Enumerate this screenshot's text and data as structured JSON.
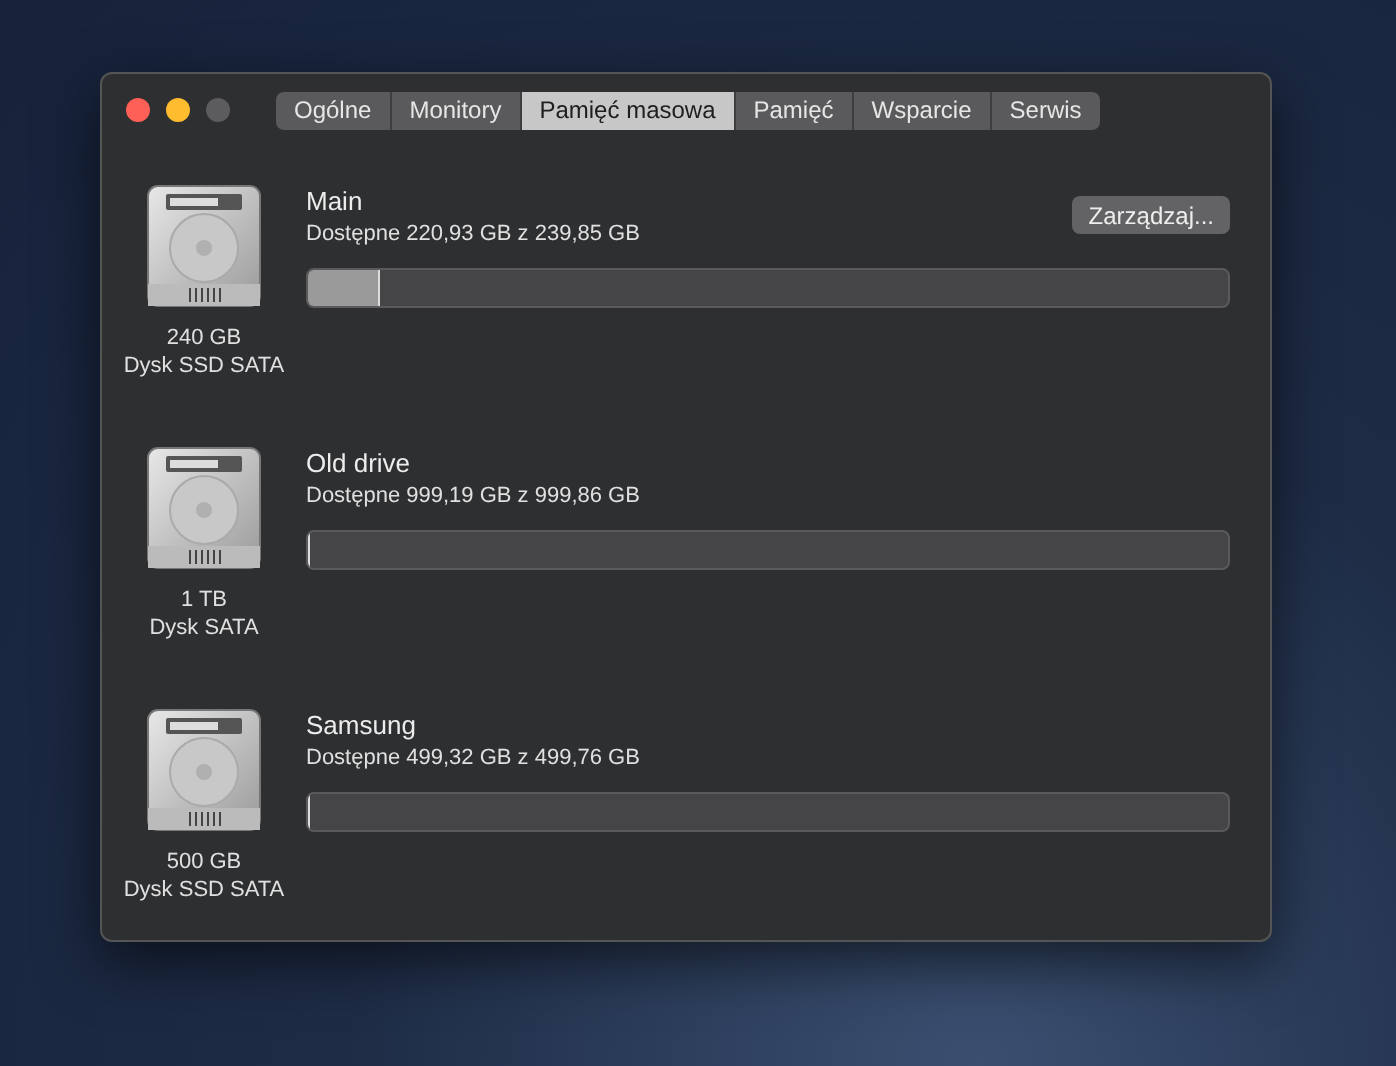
{
  "tabs": [
    {
      "label": "Ogólne",
      "selected": false
    },
    {
      "label": "Monitory",
      "selected": false
    },
    {
      "label": "Pamięć masowa",
      "selected": true
    },
    {
      "label": "Pamięć",
      "selected": false
    },
    {
      "label": "Wsparcie",
      "selected": false
    },
    {
      "label": "Serwis",
      "selected": false
    }
  ],
  "drives": [
    {
      "capacity": "240 GB",
      "type": "Dysk SSD SATA",
      "name": "Main",
      "available": "Dostępne 220,93 GB z 239,85 GB",
      "level": 0.079,
      "button": "Zarządzaj..."
    },
    {
      "capacity": "1 TB",
      "type": "Dysk SATA",
      "name": "Old drive",
      "available": "Dostępne 999,19 GB z 999,86 GB",
      "level": 0.001
    },
    {
      "capacity": "500 GB",
      "type": "Dysk SSD SATA",
      "name": "Samsung",
      "available": "Dostępne 499,32 GB z 499,76 GB",
      "level": 0.001
    }
  ]
}
